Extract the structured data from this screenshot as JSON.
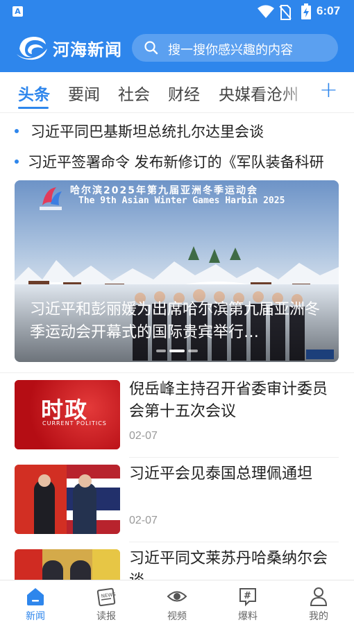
{
  "status_bar": {
    "time": "6:07"
  },
  "header": {
    "brand": "河海新闻",
    "search_placeholder": "搜一搜你感兴趣的内容"
  },
  "tabs": [
    {
      "label": "头条",
      "active": true
    },
    {
      "label": "要闻"
    },
    {
      "label": "社会"
    },
    {
      "label": "财经"
    },
    {
      "label": "央媒看沧州"
    }
  ],
  "headlines": [
    "习近平同巴基斯坦总统扎尔达里会谈",
    "习近平签署命令  发布新修订的《军队装备科研"
  ],
  "banner": {
    "event_cn": "哈尔滨2025年第九届亚洲冬季运动会",
    "event_en": "The 9th Asian Winter Games Harbin 2025",
    "caption": "习近平和彭丽媛为出席哈尔滨第九届亚洲冬季运动会开幕式的国际贵宾举行…",
    "page_count": 3,
    "active_page": 2
  },
  "news": [
    {
      "title": "倪岳峰主持召开省委审计委员会第十五次会议",
      "date": "02-07",
      "thumb_label_cn": "时政",
      "thumb_label_en": "CURRENT POLITICS"
    },
    {
      "title": "习近平会见泰国总理佩通坦",
      "date": "02-07"
    },
    {
      "title": "习近平同文莱苏丹哈桑纳尔会谈",
      "date": ""
    }
  ],
  "bottom_nav": [
    {
      "label": "新闻",
      "icon": "home-icon",
      "active": true
    },
    {
      "label": "读报",
      "icon": "newspaper-icon"
    },
    {
      "label": "视频",
      "icon": "eye-icon"
    },
    {
      "label": "爆料",
      "icon": "hashtag-icon"
    },
    {
      "label": "我的",
      "icon": "user-icon"
    }
  ],
  "colors": {
    "brand": "#2e86ec",
    "thumb_red": "#c8141b"
  }
}
